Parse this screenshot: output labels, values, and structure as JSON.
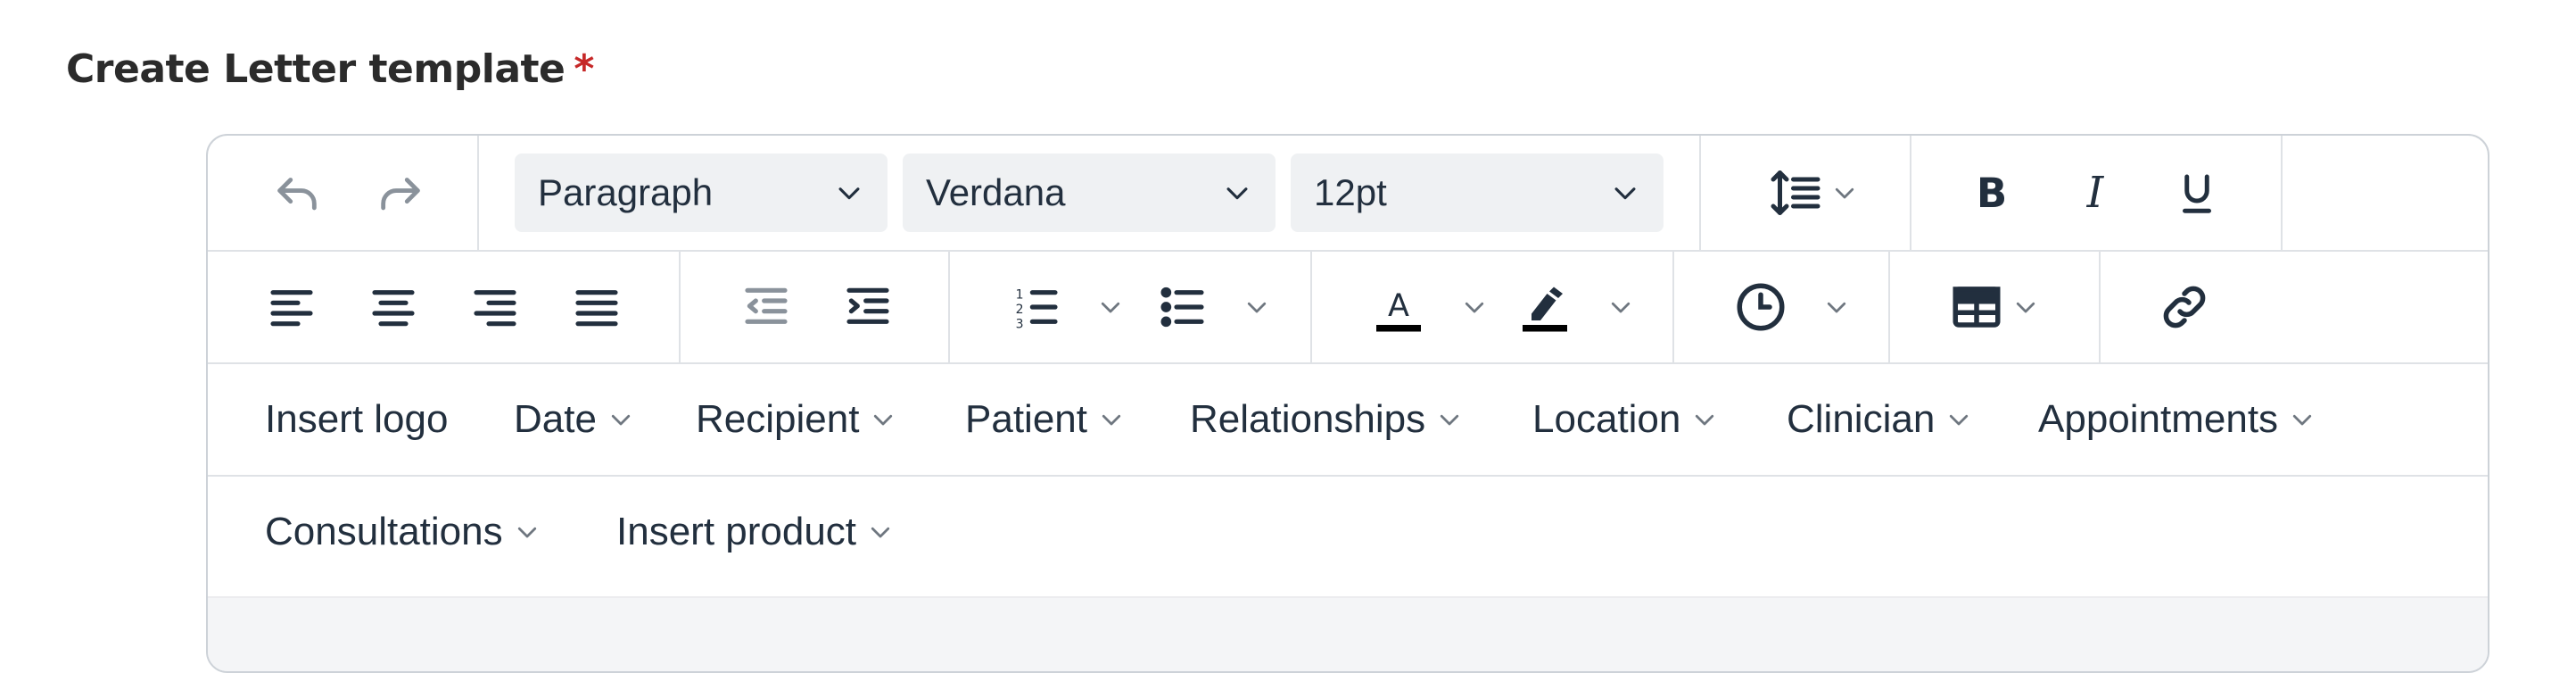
{
  "form": {
    "label": "Create Letter template",
    "required_marker": "*"
  },
  "toolbar": {
    "undo_icon": "undo-icon",
    "redo_icon": "redo-icon",
    "block_format": "Paragraph",
    "font_family": "Verdana",
    "font_size": "12pt",
    "line_height_icon": "line-height-icon",
    "bold_icon": "bold-icon",
    "italic_icon": "italic-icon",
    "underline_icon": "underline-icon",
    "align_icons": [
      "align-left-icon",
      "align-center-icon",
      "align-right-icon",
      "align-justify-icon"
    ],
    "indent_icons": [
      "outdent-icon",
      "indent-icon"
    ],
    "list_icons": [
      "numbered-list-icon",
      "bullet-list-icon"
    ],
    "text_color_icon": "text-color-icon",
    "highlight_icon": "highlight-color-icon",
    "datetime_icon": "clock-icon",
    "table_icon": "table-icon",
    "link_icon": "link-icon"
  },
  "menus": {
    "row1": [
      "Insert logo",
      "Date",
      "Recipient",
      "Patient",
      "Relationships",
      "Location",
      "Clinician",
      "Appointments"
    ],
    "row2": [
      "Consultations",
      "Insert product"
    ]
  },
  "colors": {
    "text": "#222f3e",
    "muted_icon": "#8a929b",
    "required": "#c62828",
    "border": "#cdd2d8"
  }
}
